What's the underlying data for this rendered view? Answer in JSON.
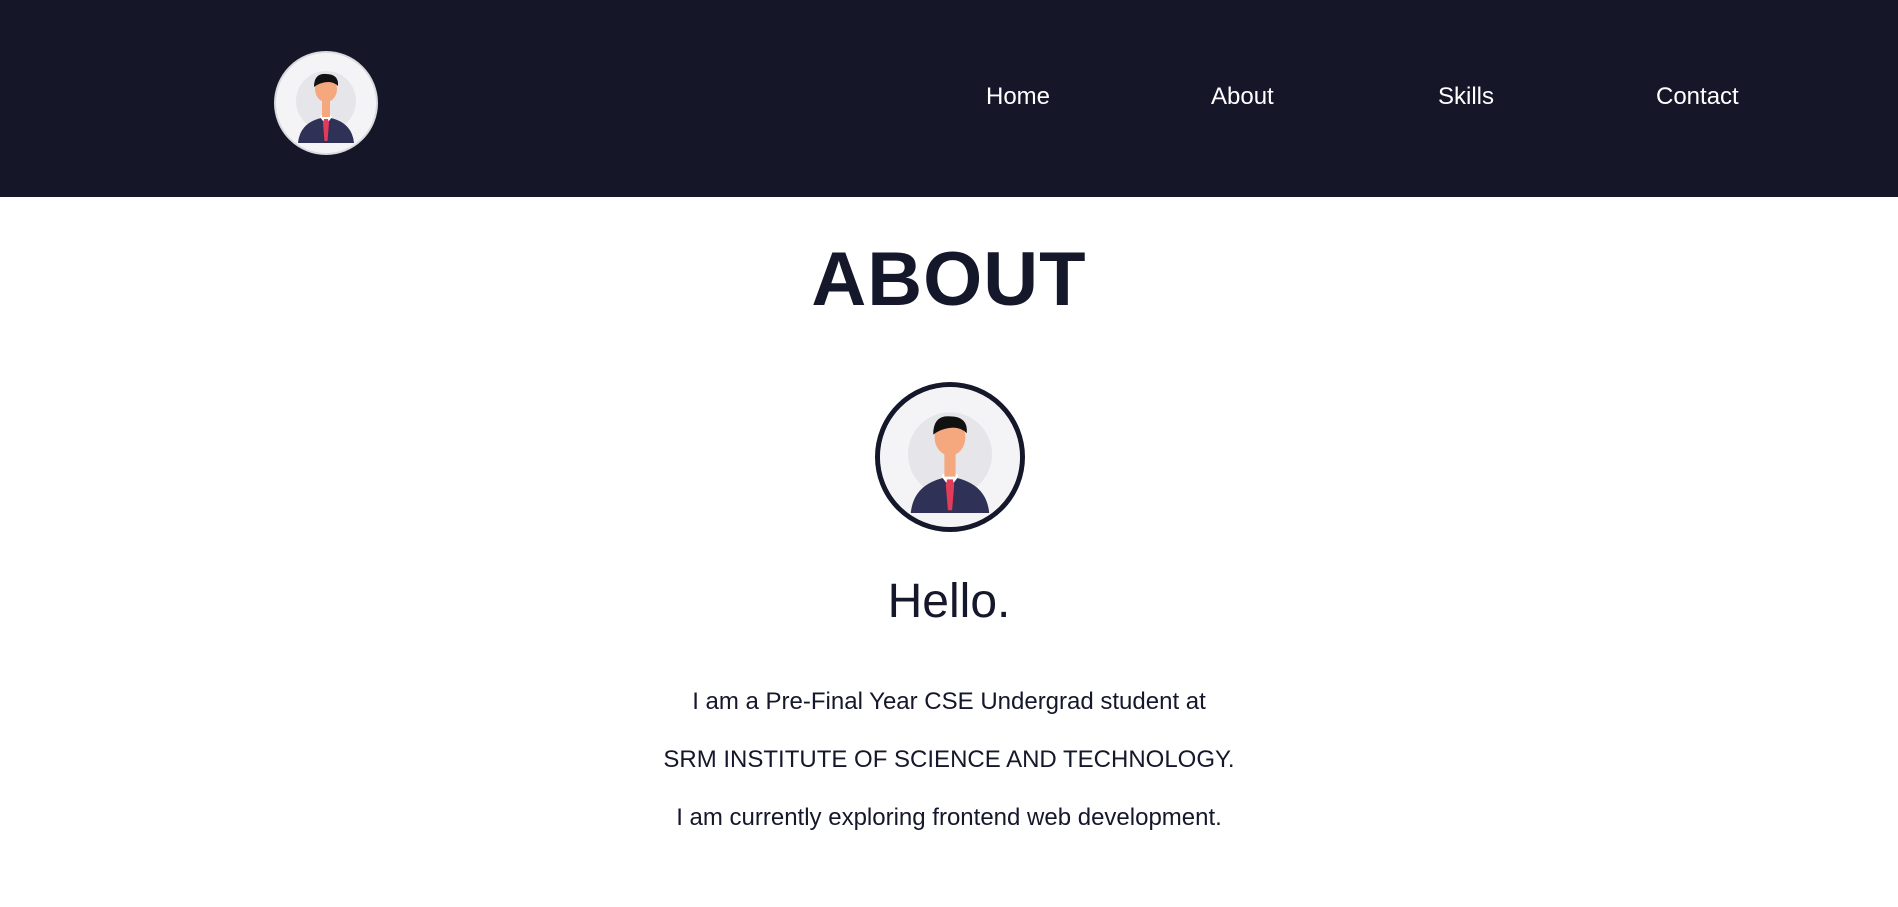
{
  "nav": {
    "logo_icon": "avatar-icon",
    "items": [
      {
        "label": "Home"
      },
      {
        "label": "About"
      },
      {
        "label": "Skills"
      },
      {
        "label": "Contact"
      }
    ]
  },
  "about": {
    "title": "ABOUT",
    "portrait_icon": "avatar-icon",
    "greeting": "Hello.",
    "bio": [
      "I am a Pre-Final Year CSE Undergrad student at",
      "SRM INSTITUTE OF SCIENCE AND TECHNOLOGY.",
      "I am currently exploring frontend web development."
    ]
  },
  "colors": {
    "header_bg": "#151628",
    "text": "#15172a",
    "nav_text": "#ffffff",
    "suit": "#2f3156",
    "tie": "#e23c5a",
    "skin": "#f5a77e"
  }
}
